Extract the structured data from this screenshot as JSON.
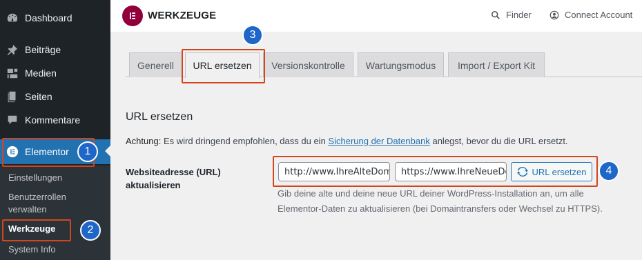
{
  "sidebar": {
    "items": [
      {
        "label": "Dashboard",
        "icon": "dashboard-icon"
      },
      {
        "label": "Beiträge",
        "icon": "pin-icon"
      },
      {
        "label": "Medien",
        "icon": "media-icon"
      },
      {
        "label": "Seiten",
        "icon": "pages-icon"
      },
      {
        "label": "Kommentare",
        "icon": "comment-icon"
      },
      {
        "label": "Elementor",
        "icon": "elementor-icon"
      }
    ],
    "submenu": [
      "Einstellungen",
      "Benutzerrollen verwalten",
      "Werkzeuge",
      "System Info"
    ]
  },
  "header": {
    "brand": "WERKZEUGE",
    "finder": "Finder",
    "connect": "Connect Account"
  },
  "tabs": [
    "Generell",
    "URL ersetzen",
    "Versionskontrolle",
    "Wartungsmodus",
    "Import / Export Kit"
  ],
  "content": {
    "heading": "URL ersetzen",
    "notice_bold": "Achtung:",
    "notice_pre": " Es wird dringend empfohlen, dass du ein ",
    "notice_link": "Sicherung der Datenbank",
    "notice_post": " anlegst, bevor du die URL ersetzt.",
    "field_label": "Websiteadresse (URL) aktualisieren",
    "old_url": "http://www.IhreAlteDomain.com",
    "new_url": "https://www.IhreNeueDomain.com",
    "button": "URL ersetzen",
    "description": "Gib deine alte und deine neue URL deiner WordPress-Installation an, um alle Elementor-Daten zu aktualisieren (bei Domaintransfers oder Wechsel zu HTTPS)."
  },
  "annotations": [
    "1",
    "2",
    "3",
    "4"
  ],
  "colors": {
    "accent": "#2271b1",
    "highlight": "#d2461e",
    "badge": "#1e66c8",
    "elementor": "#92003b"
  }
}
